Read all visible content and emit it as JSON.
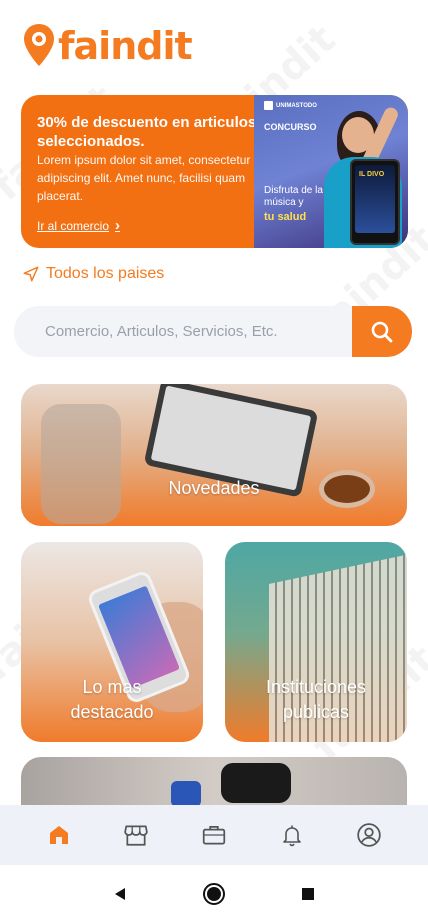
{
  "logo": {
    "text": "faindit"
  },
  "promo": {
    "title": "30% de descuento en articulos seleccionados.",
    "body": "Lorem ipsum dolor sit amet, consectetur adipiscing elit. Amet nunc, facilisi quam placerat.",
    "link_label": "Ir al comercio",
    "image": {
      "brand": "UNIMASTODO",
      "concurso": "CONCURSO",
      "disfruta": "Disfruta de la música y",
      "salud": "tu salud",
      "phone_text": "IL DIVO"
    }
  },
  "location": {
    "label": "Todos los paises"
  },
  "search": {
    "placeholder": "Comercio, Articulos, Servicios, Etc."
  },
  "categories": [
    {
      "label": "Novedades"
    },
    {
      "label": "Lo mas destacado"
    },
    {
      "label": "Instituciones publicas"
    }
  ],
  "watermark": "faindit",
  "colors": {
    "accent": "#f47b20",
    "nav_bg": "#eef1f7",
    "search_bg": "#f3f4f8"
  },
  "bottom_nav": {
    "items": [
      {
        "icon": "home-icon",
        "active": true
      },
      {
        "icon": "store-icon",
        "active": false
      },
      {
        "icon": "briefcase-icon",
        "active": false
      },
      {
        "icon": "bell-icon",
        "active": false
      },
      {
        "icon": "user-icon",
        "active": false
      }
    ]
  },
  "system_nav": {
    "items": [
      "back-icon",
      "home-circle-icon",
      "recents-icon"
    ]
  }
}
